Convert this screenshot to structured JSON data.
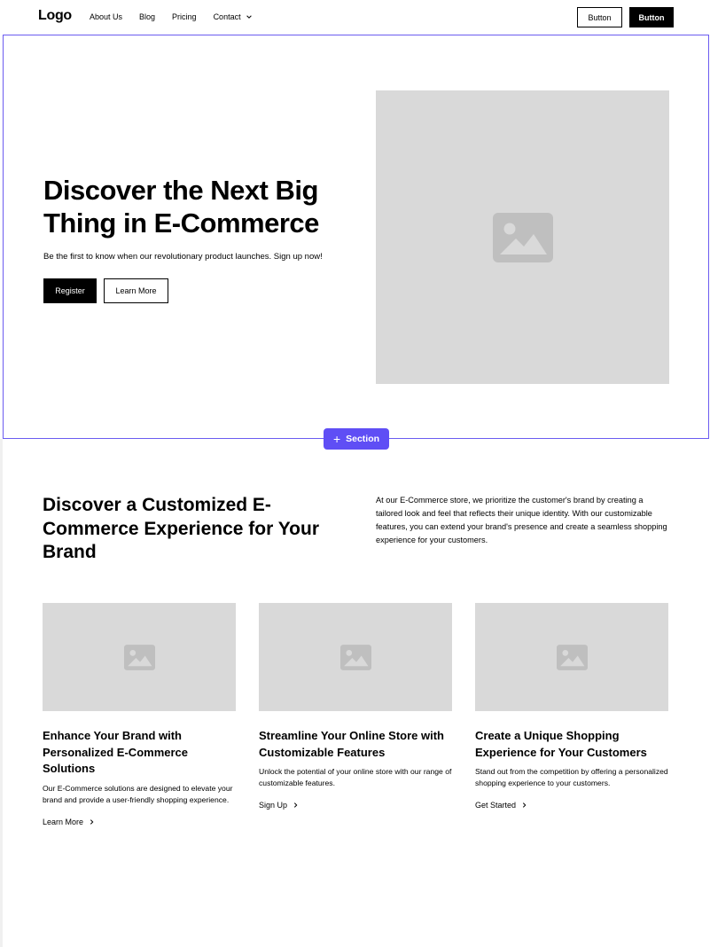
{
  "header": {
    "logo": "Logo",
    "nav": [
      "About Us",
      "Blog",
      "Pricing",
      "Contact"
    ],
    "button_outline": "Button",
    "button_solid": "Button"
  },
  "hero": {
    "title": "Discover the Next Big Thing in E-Commerce",
    "subtitle": "Be the first to know when our revolutionary product launches. Sign up now!",
    "register": "Register",
    "learn_more": "Learn More"
  },
  "section_badge": "Section",
  "features": {
    "title": "Discover a Customized E-Commerce Experience for Your Brand",
    "description": "At our E-Commerce store, we prioritize the customer's brand by creating a tailored look and feel that reflects their unique identity. With our customizable features, you can extend your brand's presence and create a seamless shopping experience for your customers.",
    "cards": [
      {
        "title": "Enhance Your Brand with Personalized E-Commerce Solutions",
        "text": "Our E-Commerce solutions are designed to elevate your brand and provide a user-friendly shopping experience.",
        "link": "Learn More"
      },
      {
        "title": "Streamline Your Online Store with Customizable Features",
        "text": "Unlock the potential of your online store with our range of customizable features.",
        "link": "Sign Up"
      },
      {
        "title": "Create a Unique Shopping Experience for Your Customers",
        "text": "Stand out from the competition by offering a personalized shopping experience to your customers.",
        "link": "Get Started"
      }
    ]
  },
  "colors": {
    "accent": "#5f4ef5",
    "placeholder": "#d9d9d9",
    "placeholder_icon": "#bfbfbf"
  }
}
